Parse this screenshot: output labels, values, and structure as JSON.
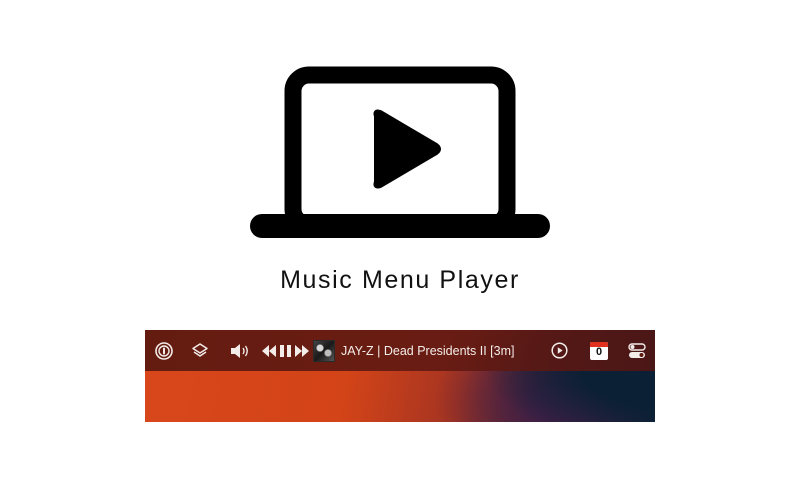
{
  "app": {
    "title": "Music Menu Player",
    "hero_icon": "laptop-play-icon"
  },
  "menubar": {
    "icons": {
      "password_manager": "password-manager-icon",
      "layers": "layers-icon",
      "volume": "speaker-volume-icon",
      "previous": "rewind-icon",
      "pause": "pause-icon",
      "next": "fast-forward-icon",
      "album_art": "album-art",
      "play_circle": "play-circle-icon",
      "calendar": "calendar-icon",
      "control_center": "control-center-toggle-icon"
    },
    "now_playing": "JAY-Z | Dead Presidents II [3m]",
    "calendar_day": "0"
  },
  "colors": {
    "menubar_bg": "#5a1810",
    "wallpaper_orange": "#d9461c",
    "wallpaper_navy": "#0b2034",
    "calendar_red": "#e0301e",
    "text_light": "#f4ece8"
  }
}
